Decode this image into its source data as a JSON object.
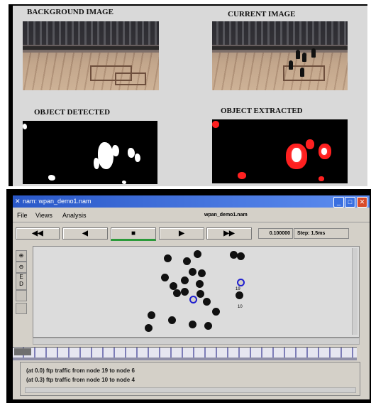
{
  "figure": {
    "labels": {
      "background": "BACKGROUND IMAGE",
      "current": "CURRENT IMAGE",
      "detected": "OBJECT DETECTED",
      "extracted": "OBJECT EXTRACTED"
    }
  },
  "window": {
    "title": "nam: wpan_demo1.nam",
    "file_label": "wpan_demo1.nam",
    "menu": [
      "File",
      "Views",
      "Analysis"
    ],
    "controls": {
      "rewind": "◀◀",
      "back": "◀",
      "stop": "■",
      "play": "▶",
      "fast_forward": "▶▶"
    },
    "time": "0.100000",
    "step": "Step: 1.5ms",
    "node_labels": [
      "19",
      "10"
    ],
    "log": [
      "(at 0.0) ftp traffic from node 19 to node 6",
      "(at 0.3) ftp traffic from node 10 to node 4"
    ]
  },
  "colors": {
    "titlebar": "#2a58c8",
    "node_highlight": "#2020d0"
  }
}
